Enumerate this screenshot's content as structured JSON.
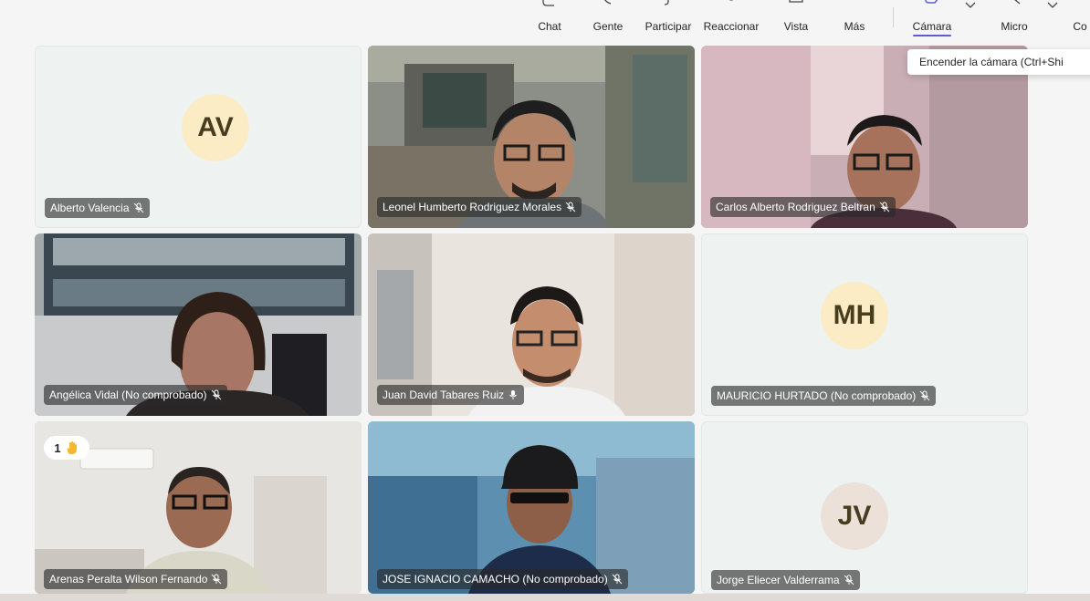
{
  "toolbar": {
    "items": [
      {
        "label": "Chat",
        "icon": "chat-icon"
      },
      {
        "label": "Gente",
        "icon": "people-icon"
      },
      {
        "label": "Participar",
        "icon": "participate-icon"
      },
      {
        "label": "Reaccionar",
        "icon": "react-icon"
      },
      {
        "label": "Vista",
        "icon": "view-icon"
      },
      {
        "label": "Más",
        "icon": "more-icon"
      },
      {
        "label": "Cámara",
        "icon": "camera-icon"
      },
      {
        "label": "Micro",
        "icon": "mic-icon"
      },
      {
        "label": "Co",
        "icon": "share-icon"
      }
    ]
  },
  "tooltip": {
    "text": "Encender la cámara (Ctrl+Shi"
  },
  "participants": [
    {
      "name": "Alberto Valencia",
      "initials": "AV",
      "avatar_color": "#fbecc6",
      "mic": "muted"
    },
    {
      "name": "Leonel Humberto Rodriguez Morales",
      "mic": "muted"
    },
    {
      "name": "Carlos Alberto Rodriguez Beltran",
      "mic": "muted"
    },
    {
      "name": "Angélica Vidal (No comprobado)",
      "mic": "muted"
    },
    {
      "name": "Juan David Tabares Ruiz",
      "mic": "on",
      "speaking": true
    },
    {
      "name": "MAURICIO HURTADO (No comprobado)",
      "initials": "MH",
      "avatar_color": "#fbecc6",
      "mic": "muted"
    },
    {
      "name": "Arenas Peralta Wilson Fernando",
      "mic": "muted",
      "hand_raised": true,
      "hand_count": "1"
    },
    {
      "name": "JOSE IGNACIO CAMACHO (No comprobado)",
      "mic": "muted"
    },
    {
      "name": "Jorge Eliecer Valderrama",
      "initials": "JV",
      "avatar_color": "#ece1d9",
      "mic": "muted"
    }
  ],
  "colors": {
    "speaking": "#5b5fc7",
    "hand": "#e4a11b"
  }
}
